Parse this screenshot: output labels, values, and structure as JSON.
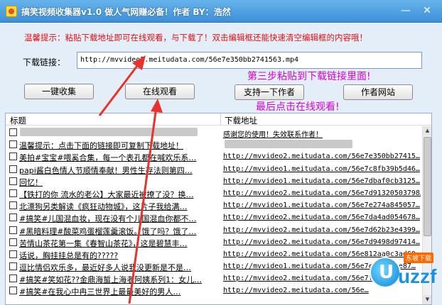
{
  "window": {
    "title": "搞笑视频收集器v1.0   做人气网赚必备！作者 BY：浩然",
    "minimize": "—",
    "close": "✕"
  },
  "hint": "温馨提示：粘贴下载地址即可在线观看，与下载了！双击编辑框还能快速清空编辑框的内容哦！",
  "download": {
    "label": "下载链接：",
    "value": "http://mvvideo2.meitudata.com/56e7e350bb2741563.mp4"
  },
  "buttons": {
    "collect": "一键收集",
    "watch": "在线观看",
    "support": "支持一下作者",
    "website": "作者网站"
  },
  "callouts": {
    "step3": "第三步粘贴到下载链接里面!",
    "last": "最后点击在线观看!"
  },
  "list": {
    "columns": {
      "title": "标题",
      "url": "下载地址"
    },
    "rows": [
      {
        "title": "",
        "url": "感谢您的使用！失效联系作者！",
        "title_blurred": true
      },
      {
        "title": "温馨提示：点击下面的链接即可复制下载地址！",
        "url": "",
        "url_blurred": true
      },
      {
        "title": "美拍#宝宝#喂奚合集，每一个表孔都在喊欢乐系…",
        "url": "http://mvvideo2.meitudata.com/56e7e350bb27415…"
      },
      {
        "title": "papi酱白色情人节顺情奉献！男性生存法则第四…",
        "url": "http://mvvideo1.meitudata.com/56e7c8fb39b5d46…"
      },
      {
        "title": "回忆！",
        "url": "http://mvvideo1.meitudata.com/56e7dbaf0cb3125…"
      },
      {
        "title": "【铁打的你 流水的老公】大家最近被撩了没？换…",
        "url": "http://mvvideo2.meitudata.com/56e7d91320503798…"
      },
      {
        "title": "北漂狗另类解读《疯狂动物城》，这片子我给满…",
        "url": "http://mvvideo1.meitudata.com/56e7e274a845057…"
      },
      {
        "title": "#搞笑#儿国混血妆，现在没有个儿国混血你都不…",
        "url": "http://mvvideo2.meitudata.com/56e7da4ad054678…"
      },
      {
        "title": "#黑暗料理#酸菜鸡蛋榴莲羹滚饭。饿了吗？饿了…",
        "url": "http://mvvideo2.meitudata.com/56e7d62b23e4399…"
      },
      {
        "title": "苦情山茶花第一集《春智山茶花》，这是碧慧丰…",
        "url": "http://mvvideo2.meitudata.com/56e7d9498d97414…"
      },
      {
        "title": "话说，胸挂挂总是有的?????",
        "url": "http://mvvideo2.meitudata.com/56e812aa0c3ad60…"
      },
      {
        "title": "逗比情侣欢乐多，最近好多人说我没更新是不是…",
        "url": "http://mvvideo1.meitudata.com/56e7e787744e87…"
      },
      {
        "title": "#搞笑#笑如花??金鼎海蜇上海老阿姨系列1：女儿…",
        "url": "http://mvvideo2.meitudata.com/56e7f…"
      },
      {
        "title": "#搞笑#在我心中冉三世界上最最美好的男人…",
        "url": "http://mvvideo2.meitudata.com/56e…"
      }
    ]
  },
  "watermark": {
    "brand": "uzzf",
    "badge": "东坡下载"
  },
  "colors": {
    "hint": "#e01010",
    "callout": "#d900d9",
    "arrow": "#e8322b",
    "titlebar": "#4a9be0"
  }
}
